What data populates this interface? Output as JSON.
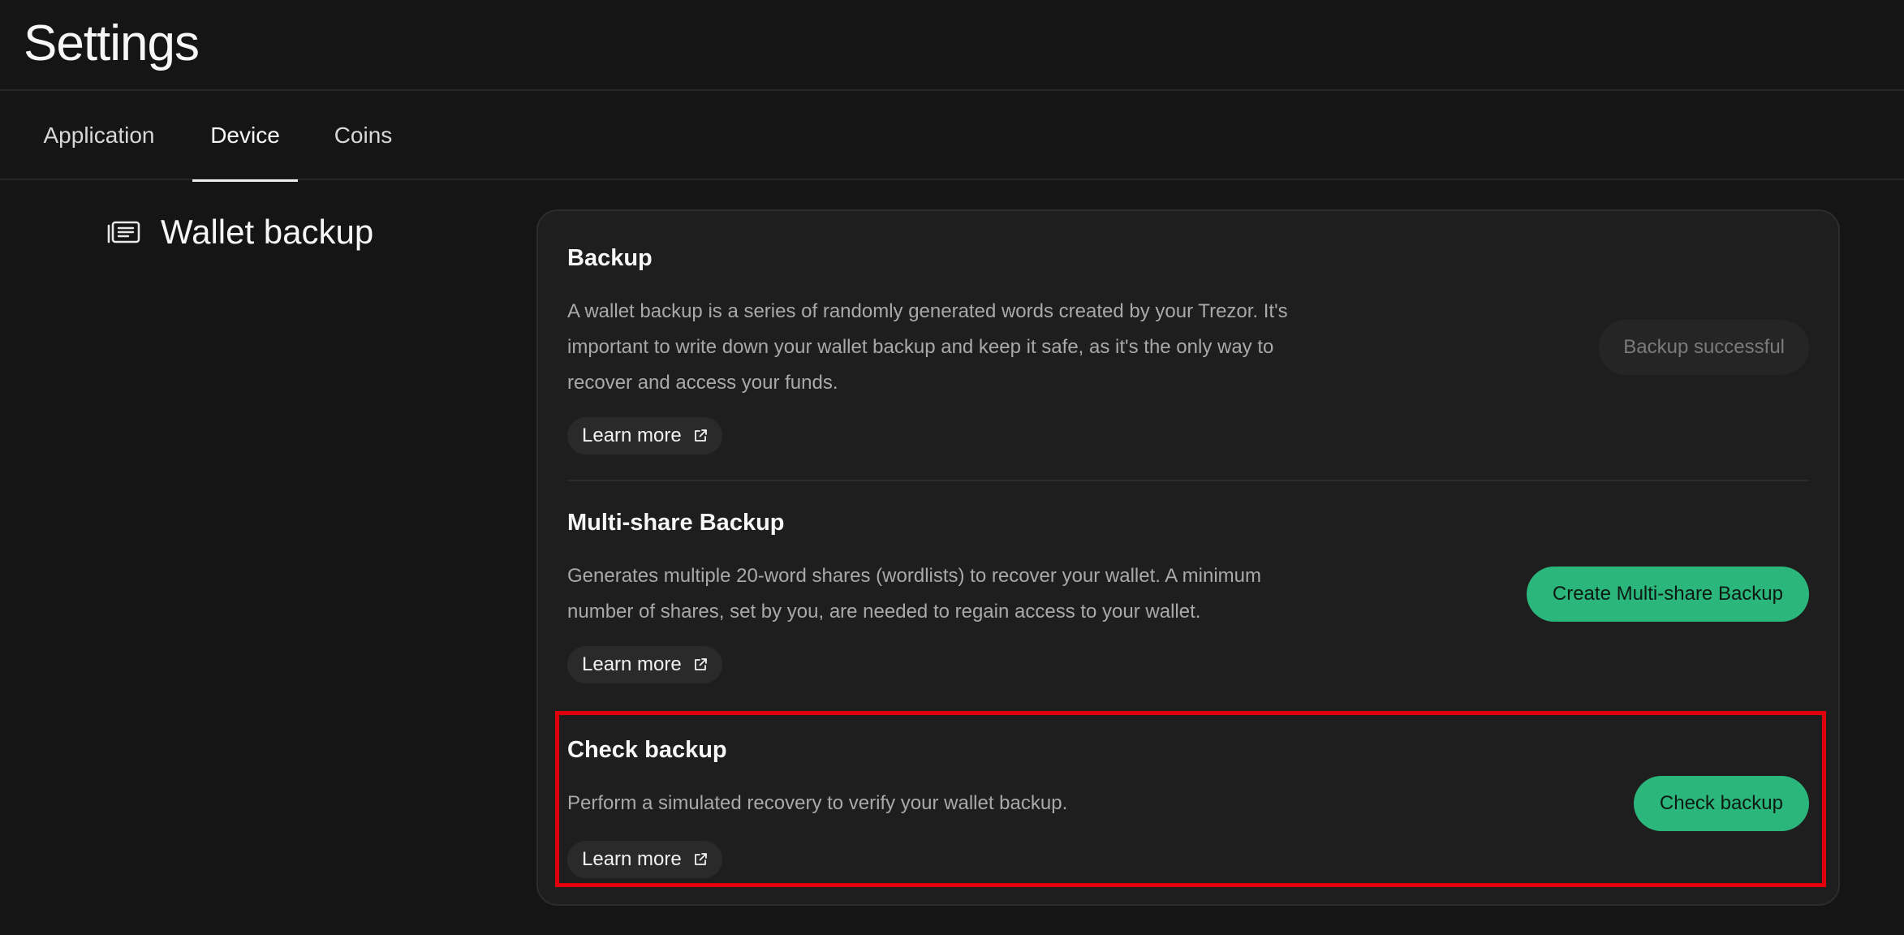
{
  "header": {
    "title": "Settings"
  },
  "tabs": [
    {
      "label": "Application"
    },
    {
      "label": "Device"
    },
    {
      "label": "Coins"
    }
  ],
  "active_tab": "Device",
  "section": {
    "title": "Wallet backup",
    "icon": "wallet-backup-icon"
  },
  "rows": {
    "backup": {
      "title": "Backup",
      "description": "A wallet backup is a series of randomly generated words created by your Trezor. It's important to write down your wallet backup and keep it safe, as it's the only way to recover and access your funds.",
      "learn_more": "Learn more",
      "status": "Backup successful"
    },
    "multishare": {
      "title": "Multi-share Backup",
      "description": "Generates multiple 20-word shares (wordlists) to recover your wallet. A minimum number of shares, set by you, are needed to regain access to your wallet.",
      "learn_more": "Learn more",
      "action": "Create Multi-share Backup"
    },
    "check": {
      "title": "Check backup",
      "description": "Perform a simulated recovery to verify your wallet backup.",
      "learn_more": "Learn more",
      "action": "Check backup"
    }
  },
  "colors": {
    "background": "#151515",
    "card": "#1e1e1e",
    "accent_green": "#2bb67c",
    "highlight_red": "#e0000b"
  }
}
